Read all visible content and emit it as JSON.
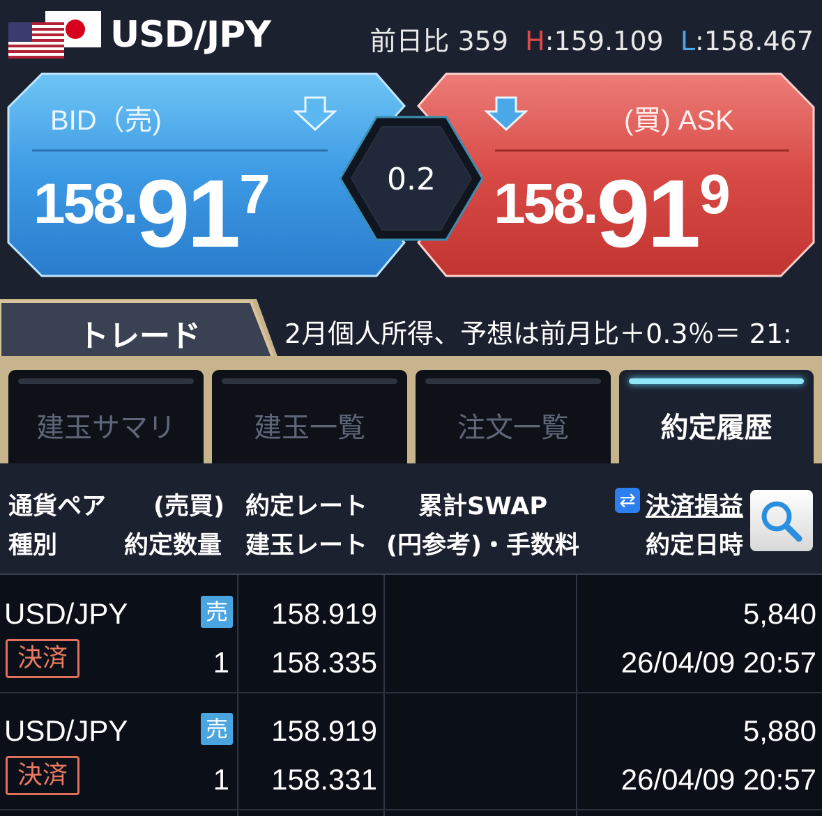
{
  "header": {
    "pair": "USD/JPY",
    "change_label": "前日比",
    "change_value": "359",
    "high_label": "H",
    "high_value": "159.109",
    "low_label": "L",
    "low_value": "158.467"
  },
  "bid": {
    "label": "BID（売)",
    "price_main": "158.",
    "price_big": "91",
    "price_pip": "7",
    "arrow": "down-arrow-icon"
  },
  "ask": {
    "label": "(買) ASK",
    "price_main": "158.",
    "price_big": "91",
    "price_pip": "9",
    "arrow": "down-arrow-icon"
  },
  "spread": "0.2",
  "trade_tab": "トレード",
  "ticker": "2月個人所得、予想は前月比＋0.3％＝ 21:",
  "subtabs": [
    {
      "label": "建玉サマリ",
      "active": false
    },
    {
      "label": "建玉一覧",
      "active": false
    },
    {
      "label": "注文一覧",
      "active": false
    },
    {
      "label": "約定履歴",
      "active": true
    }
  ],
  "columns": {
    "pair": "通貨ペア",
    "type": "種別",
    "side": "(売買)",
    "qty": "約定数量",
    "rate": "約定レート",
    "pos_rate": "建玉レート",
    "swap": "累計SWAP",
    "swap_sub": "(円参考)・手数料",
    "pnl": "決済損益",
    "datetime": "約定日時"
  },
  "rows": [
    {
      "pair": "USD/JPY",
      "side": "売",
      "type": "決済",
      "qty": "1",
      "rate": "158.919",
      "pos_rate": "158.335",
      "pnl": "5,840",
      "datetime": "26/04/09 20:57"
    },
    {
      "pair": "USD/JPY",
      "side": "売",
      "type": "決済",
      "qty": "1",
      "rate": "158.919",
      "pos_rate": "158.331",
      "pnl": "5,880",
      "datetime": "26/04/09 20:57"
    }
  ],
  "colors": {
    "bid": "#3a9ae6",
    "ask": "#d84a45",
    "active_tab_bar": "#8ee6f6",
    "sell_badge": "#4aa4e0",
    "settle_badge": "#e0705c"
  }
}
